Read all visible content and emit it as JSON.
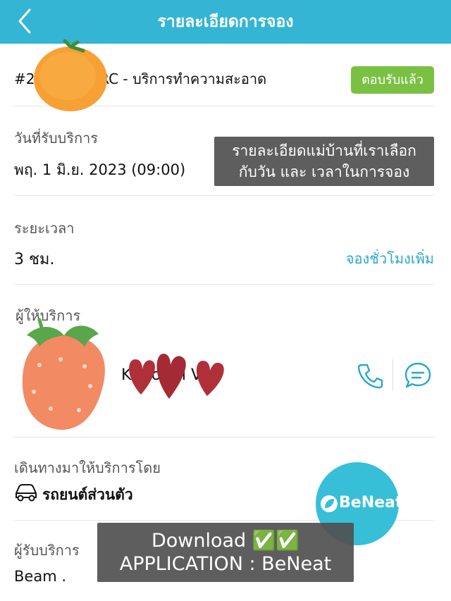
{
  "header": {
    "title": "รายละเอียดการจอง",
    "back_icon": "chevron-left-icon"
  },
  "order": {
    "id_prefix": "#2",
    "id_suffix": "BRC - บริการทำความสะอาด",
    "status": "ตอบรับแล้ว"
  },
  "service_date": {
    "label": "วันที่รับบริการ",
    "value": "พฤ. 1 มิ.ย. 2023 (09:00)"
  },
  "booking_note": {
    "line1": "รายละเอียดแม่บ้านที่เราเลือก",
    "line2": "กับวัน และ เวลาในการจอง"
  },
  "duration": {
    "label": "ระยะเวลา",
    "value": "3 ชม.",
    "extend_link": "จองชั่วโมงเพิ่ม"
  },
  "provider": {
    "label": "ผู้ให้บริการ",
    "name": "K  mo  thi  V.",
    "phone_icon": "phone-icon",
    "chat_icon": "chat-bubble-icon"
  },
  "travel": {
    "label": "เดินทางมาให้บริการโดย",
    "value": "รถยนต์ส่วนตัว",
    "icon": "car-icon"
  },
  "customer": {
    "label": "ผู้รับบริการ",
    "value": "Beam ."
  },
  "promo": {
    "line1": "Download ✅✅",
    "line2": "APPLICATION : BeNeat"
  },
  "badge": {
    "text": "BeNeat"
  },
  "colors": {
    "header": "#33b5d3",
    "status_badge": "#7ac143",
    "link": "#29a8c8",
    "overlay": "#505050"
  }
}
